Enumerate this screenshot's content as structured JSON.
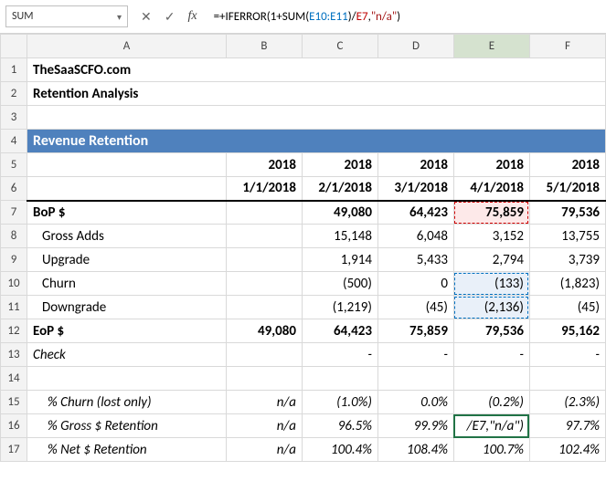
{
  "chart_data": {
    "type": "table",
    "title": "Revenue Retention",
    "columns": [
      "",
      "2018 1/1/2018",
      "2018 2/1/2018",
      "2018 3/1/2018",
      "2018 4/1/2018",
      "2018 5/1/2018"
    ],
    "rows": [
      {
        "label": "BoP $",
        "values": [
          "",
          "49,080",
          "64,423",
          "75,859",
          "79,536"
        ]
      },
      {
        "label": "Gross Adds",
        "values": [
          "",
          "15,148",
          "6,048",
          "3,152",
          "13,755"
        ]
      },
      {
        "label": "Upgrade",
        "values": [
          "",
          "1,914",
          "5,433",
          "2,794",
          "3,739"
        ]
      },
      {
        "label": "Churn",
        "values": [
          "",
          "(500)",
          "0",
          "(133)",
          "(1,823)"
        ]
      },
      {
        "label": "Downgrade",
        "values": [
          "",
          "(1,219)",
          "(45)",
          "(2,136)",
          "(45)"
        ]
      },
      {
        "label": "EoP $",
        "values": [
          "49,080",
          "64,423",
          "75,859",
          "79,536",
          "95,162"
        ]
      },
      {
        "label": "Check",
        "values": [
          "",
          "-",
          "-",
          "-",
          "-"
        ]
      },
      {
        "label": "% Churn (lost only)",
        "values": [
          "n/a",
          "(1.0%)",
          "0.0%",
          "(0.2%)",
          "(2.3%)"
        ]
      },
      {
        "label": "% Gross $ Retention",
        "values": [
          "n/a",
          "96.5%",
          "99.9%",
          "/E7,\"n/a\")",
          "97.7%"
        ]
      },
      {
        "label": "% Net $ Retention",
        "values": [
          "n/a",
          "100.4%",
          "108.4%",
          "100.7%",
          "102.4%"
        ]
      }
    ]
  },
  "formula_bar": {
    "name_box": "SUM",
    "formula_prefix": "=+IFERROR(1+SUM(",
    "formula_range": "E10:E11",
    "formula_mid": ")/",
    "formula_ref": "E7",
    "formula_comma": ",",
    "formula_str": "\"n/a\"",
    "formula_end": ")"
  },
  "col_headers": [
    "",
    "A",
    "B",
    "C",
    "D",
    "E",
    "F"
  ],
  "rows": {
    "1": {
      "A": "TheSaaSCFO.com",
      "B": "",
      "C": "",
      "D": "",
      "E": "",
      "F": ""
    },
    "2": {
      "A": "Retention Analysis",
      "B": "",
      "C": "",
      "D": "",
      "E": "",
      "F": ""
    },
    "3": {
      "A": "",
      "B": "",
      "C": "",
      "D": "",
      "E": "",
      "F": ""
    },
    "4": {
      "A": "Revenue Retention",
      "B": "",
      "C": "",
      "D": "",
      "E": "",
      "F": ""
    },
    "5": {
      "A": "",
      "B": "2018",
      "C": "2018",
      "D": "2018",
      "E": "2018",
      "F": "2018"
    },
    "6": {
      "A": "",
      "B": "1/1/2018",
      "C": "2/1/2018",
      "D": "3/1/2018",
      "E": "4/1/2018",
      "F": "5/1/2018"
    },
    "7": {
      "A": "BoP $",
      "B": "",
      "C": "49,080",
      "D": "64,423",
      "E": "75,859",
      "F": "79,536"
    },
    "8": {
      "A": "Gross Adds",
      "B": "",
      "C": "15,148",
      "D": "6,048",
      "E": "3,152",
      "F": "13,755"
    },
    "9": {
      "A": "Upgrade",
      "B": "",
      "C": "1,914",
      "D": "5,433",
      "E": "2,794",
      "F": "3,739"
    },
    "10": {
      "A": "Churn",
      "B": "",
      "C": "(500)",
      "D": "0",
      "E": "(133)",
      "F": "(1,823)"
    },
    "11": {
      "A": "Downgrade",
      "B": "",
      "C": "(1,219)",
      "D": "(45)",
      "E": "(2,136)",
      "F": "(45)"
    },
    "12": {
      "A": "EoP $",
      "B": "49,080",
      "C": "64,423",
      "D": "75,859",
      "E": "79,536",
      "F": "95,162"
    },
    "13": {
      "A": "Check",
      "B": "",
      "C": "-",
      "D": "-",
      "E": "-",
      "F": "-"
    },
    "14": {
      "A": "",
      "B": "",
      "C": "",
      "D": "",
      "E": "",
      "F": ""
    },
    "15": {
      "A": "% Churn (lost only)",
      "B": "n/a",
      "C": "(1.0%)",
      "D": "0.0%",
      "E": "(0.2%)",
      "F": "(2.3%)"
    },
    "16": {
      "A": "% Gross $ Retention",
      "B": "n/a",
      "C": "96.5%",
      "D": "99.9%",
      "E": "/E7,\"n/a\")",
      "F": "97.7%"
    },
    "17": {
      "A": "% Net $ Retention",
      "B": "n/a",
      "C": "100.4%",
      "D": "108.4%",
      "E": "100.7%",
      "F": "102.4%"
    }
  }
}
